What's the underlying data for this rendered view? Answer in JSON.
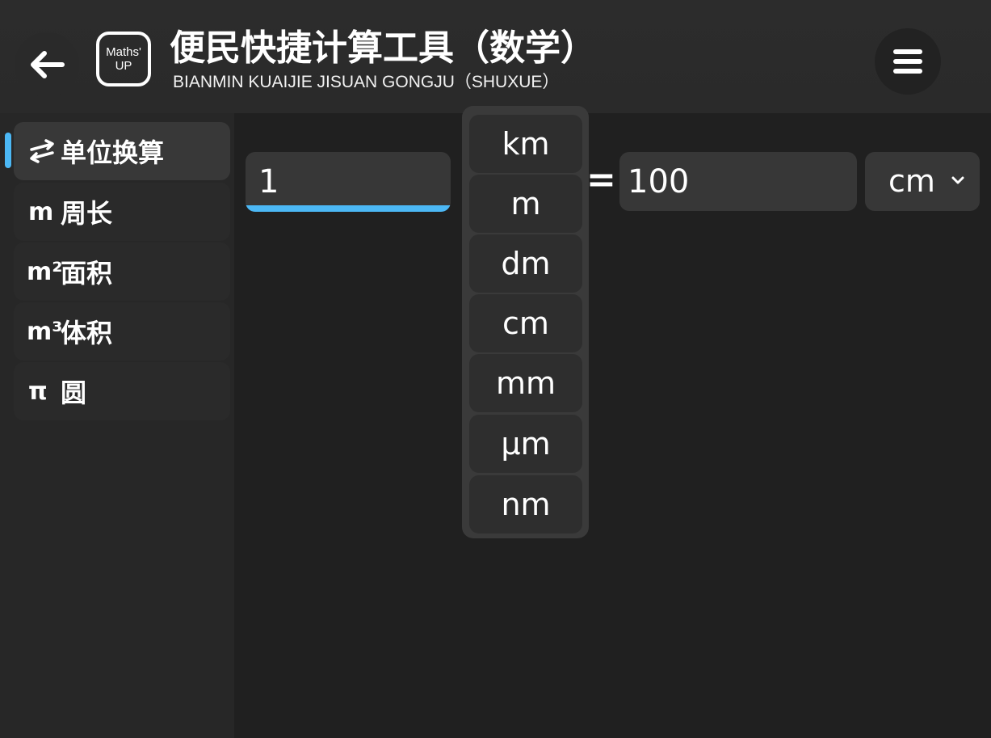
{
  "header": {
    "title": "便民快捷计算工具（数学）",
    "subtitle": "BIANMIN KUAIJIE JISUAN GONGJU（SHUXUE）",
    "logo_line1": "Maths'",
    "logo_line2": "UP",
    "back_icon": "arrow-left-icon",
    "menu_icon": "hamburger-menu-icon"
  },
  "sidebar": {
    "items": [
      {
        "icon": "⇄",
        "icon_name": "swap-arrows-icon",
        "label": "单位换算",
        "active": true
      },
      {
        "icon": "m",
        "icon_name": "meter-icon",
        "label": "周长",
        "active": false
      },
      {
        "icon": "m²",
        "icon_name": "square-meter-icon",
        "label": "面积",
        "active": false
      },
      {
        "icon": "m³",
        "icon_name": "cubic-meter-icon",
        "label": "体积",
        "active": false
      },
      {
        "icon": "π",
        "icon_name": "pi-icon",
        "label": "圆",
        "active": false
      }
    ]
  },
  "converter": {
    "input_value": "1",
    "from_unit_options": [
      "km",
      "m",
      "dm",
      "cm",
      "mm",
      "µm",
      "nm"
    ],
    "equals": "=",
    "result_value": "100",
    "to_unit": "cm"
  },
  "colors": {
    "accent": "#4cb8f5",
    "background": "#202020",
    "header": "#2b2b2b",
    "field": "#373737"
  }
}
